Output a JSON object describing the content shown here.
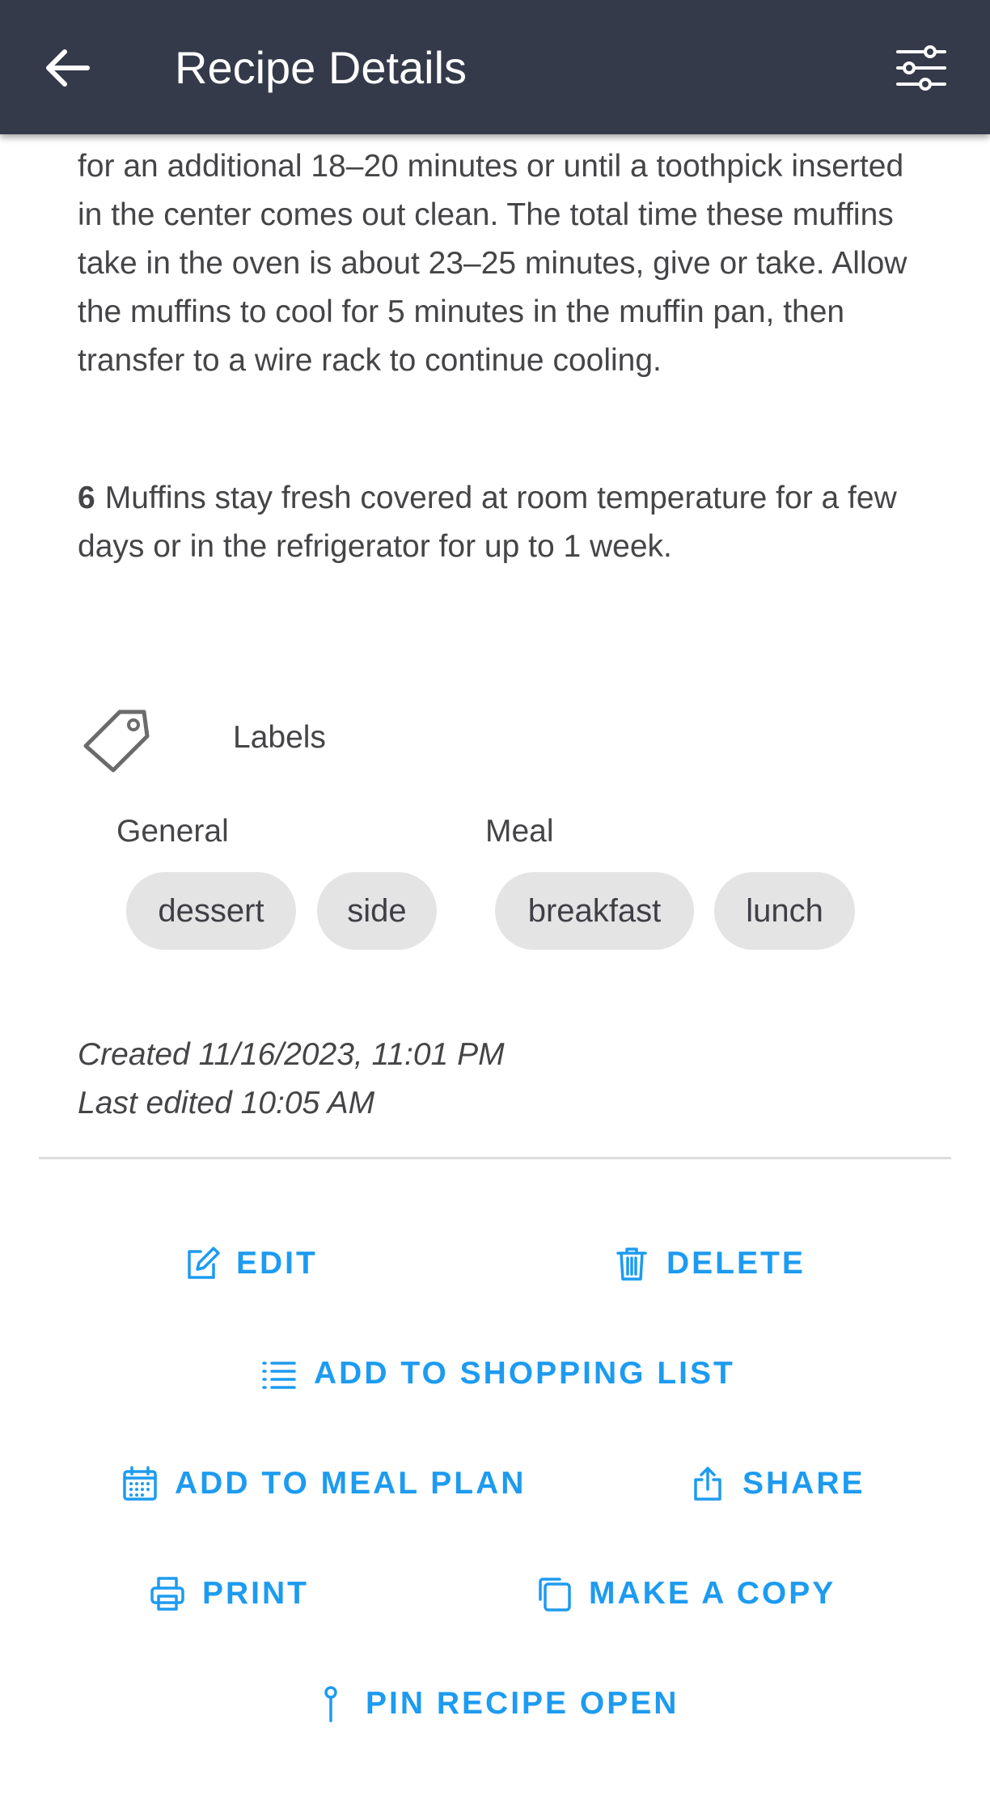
{
  "header": {
    "title": "Recipe Details",
    "back_icon": "arrow-left-icon",
    "filter_icon": "sliders-icon"
  },
  "instructions": {
    "step5_tail": "for an additional 18–20 minutes or until a toothpick inserted in the center comes out clean. The total time these muffins take in the oven is about 23–25 minutes, give or take. Allow the muffins to cool for 5 minutes in the muffin pan, then transfer to a wire rack to continue cooling.",
    "step6_number": "6",
    "step6_text": "Muffins stay fresh covered at room temperature for a few days or in the refrigerator for up to 1 week."
  },
  "labels": {
    "heading": "Labels",
    "icon": "tag-icon",
    "groups": [
      {
        "title": "General",
        "chips": [
          "dessert",
          "side"
        ]
      },
      {
        "title": "Meal",
        "chips": [
          "breakfast",
          "lunch"
        ]
      }
    ]
  },
  "meta": {
    "created": "Created 11/16/2023, 11:01 PM",
    "edited": "Last edited 10:05 AM"
  },
  "actions": {
    "edit": "EDIT",
    "delete": "DELETE",
    "shopping": "ADD TO SHOPPING LIST",
    "meal_plan": "ADD TO MEAL PLAN",
    "share": "SHARE",
    "print": "PRINT",
    "copy": "MAKE A COPY",
    "pin": "PIN RECIPE OPEN"
  },
  "colors": {
    "appbar": "#343a4a",
    "accent": "#1d9bf0",
    "chip": "#e4e4e4"
  }
}
